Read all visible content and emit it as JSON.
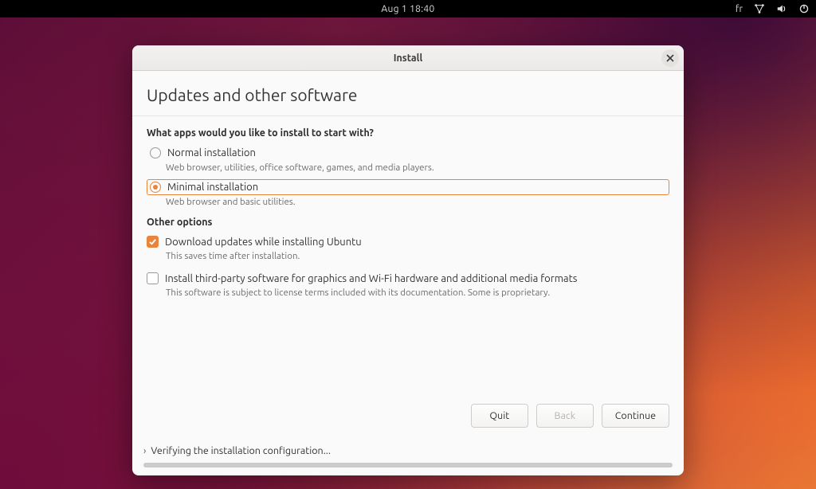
{
  "topbar": {
    "clock": "Aug 1  18:40",
    "lang": "fr",
    "icons": {
      "network": "network-icon",
      "sound": "volume-icon",
      "power": "power-icon"
    }
  },
  "dialog": {
    "title": "Install",
    "heading": "Updates and other software",
    "question": "What apps would you like to install to start with?",
    "options": {
      "normal": {
        "label": "Normal installation",
        "desc": "Web browser, utilities, office software, games, and media players.",
        "selected": false
      },
      "minimal": {
        "label": "Minimal installation",
        "desc": "Web browser and basic utilities.",
        "selected": true
      }
    },
    "other_heading": "Other options",
    "checks": {
      "download": {
        "label": "Download updates while installing Ubuntu",
        "desc": "This saves time after installation.",
        "checked": true
      },
      "thirdparty": {
        "label": "Install third-party software for graphics and Wi-Fi hardware and additional media formats",
        "desc": "This software is subject to license terms included with its documentation. Some is proprietary.",
        "checked": false
      }
    },
    "buttons": {
      "quit": "Quit",
      "back": "Back",
      "continue": "Continue"
    },
    "progress": {
      "label": "Verifying the installation configuration...",
      "percent": 100
    }
  }
}
